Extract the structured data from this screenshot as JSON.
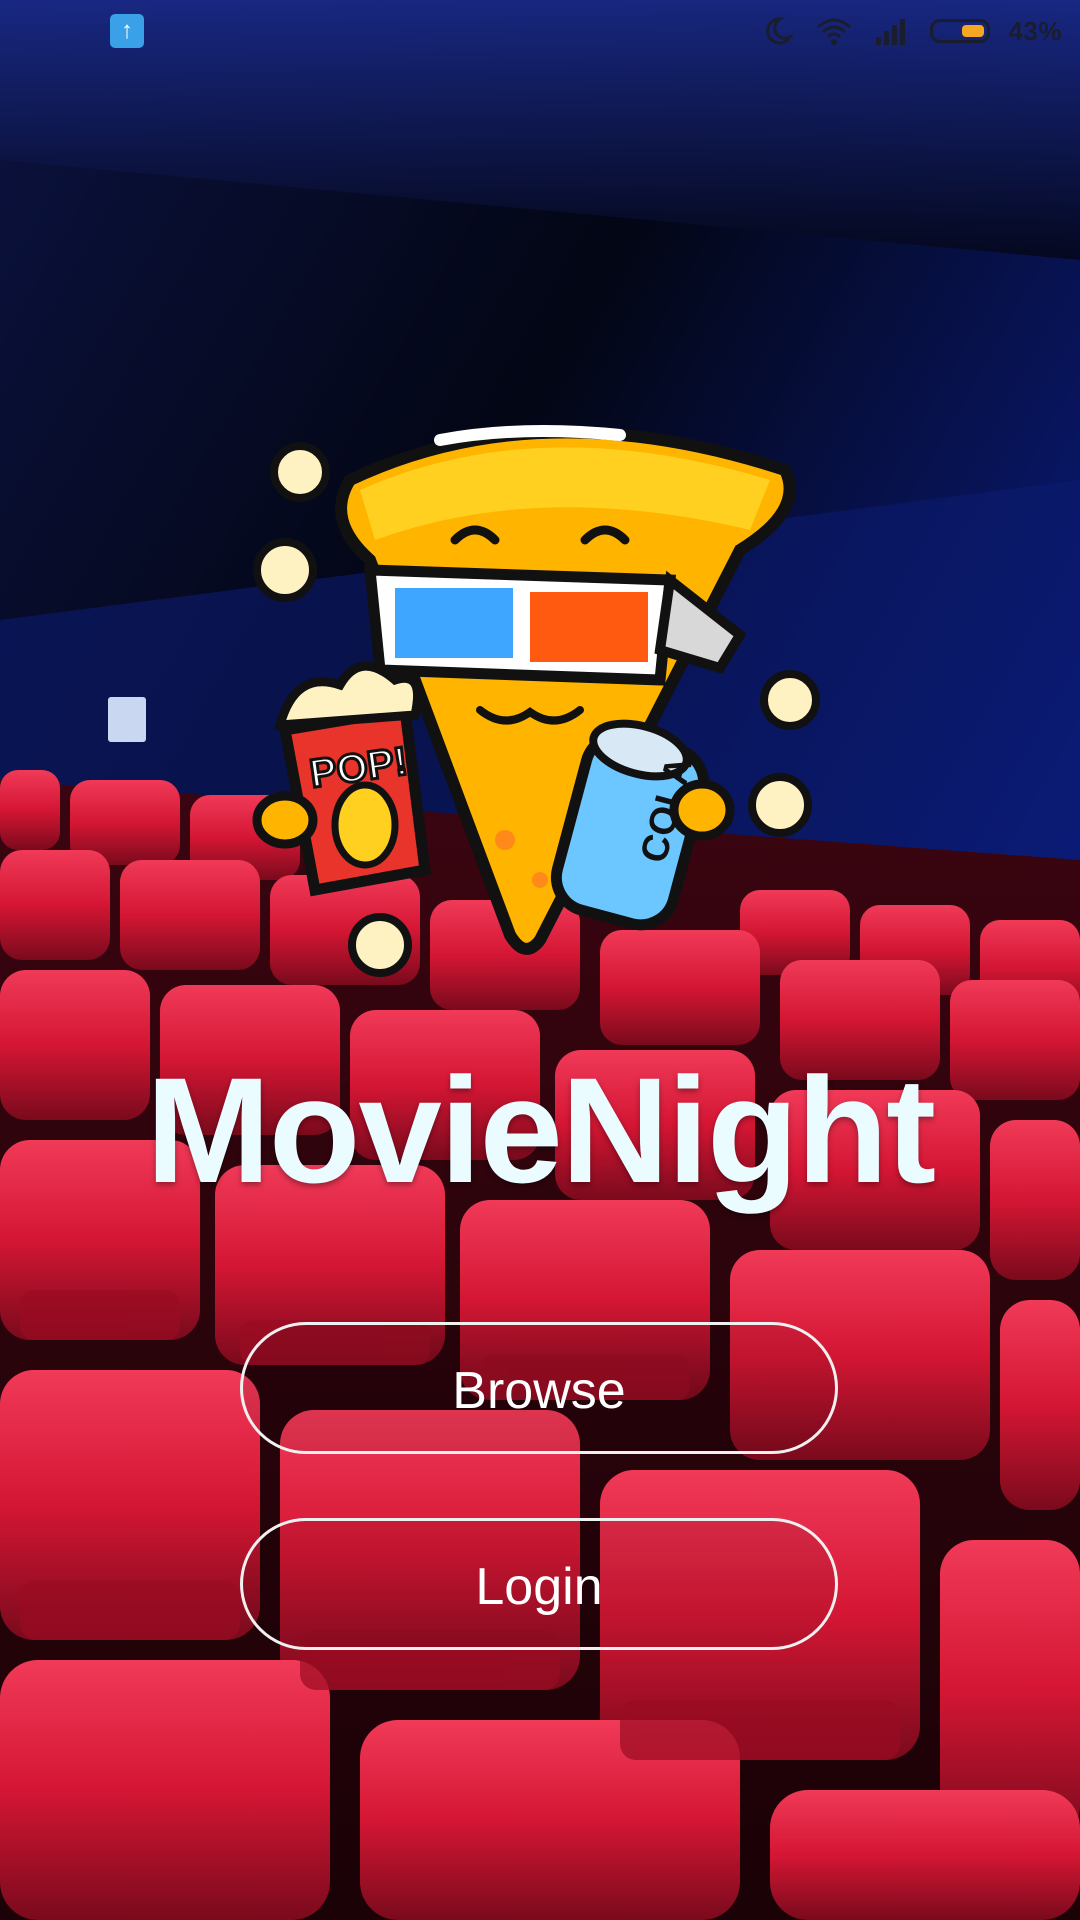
{
  "app": {
    "title": "MovieNight"
  },
  "status_bar": {
    "battery_level": "43%",
    "icons": [
      "upload-icon",
      "moon-icon",
      "wifi-icon",
      "signal-icon",
      "battery-icon"
    ]
  },
  "mascot": {
    "popcorn_box_text": "POP!",
    "can_text": "COLA"
  },
  "buttons": {
    "browse_label": "Browse",
    "login_label": "Login"
  },
  "colors": {
    "title": "#eafcff",
    "button_border": "#f0f0f0",
    "seat_red": "#d81836",
    "wall_blue": "#0f1f8a",
    "accent_battery": "#f5a623"
  }
}
